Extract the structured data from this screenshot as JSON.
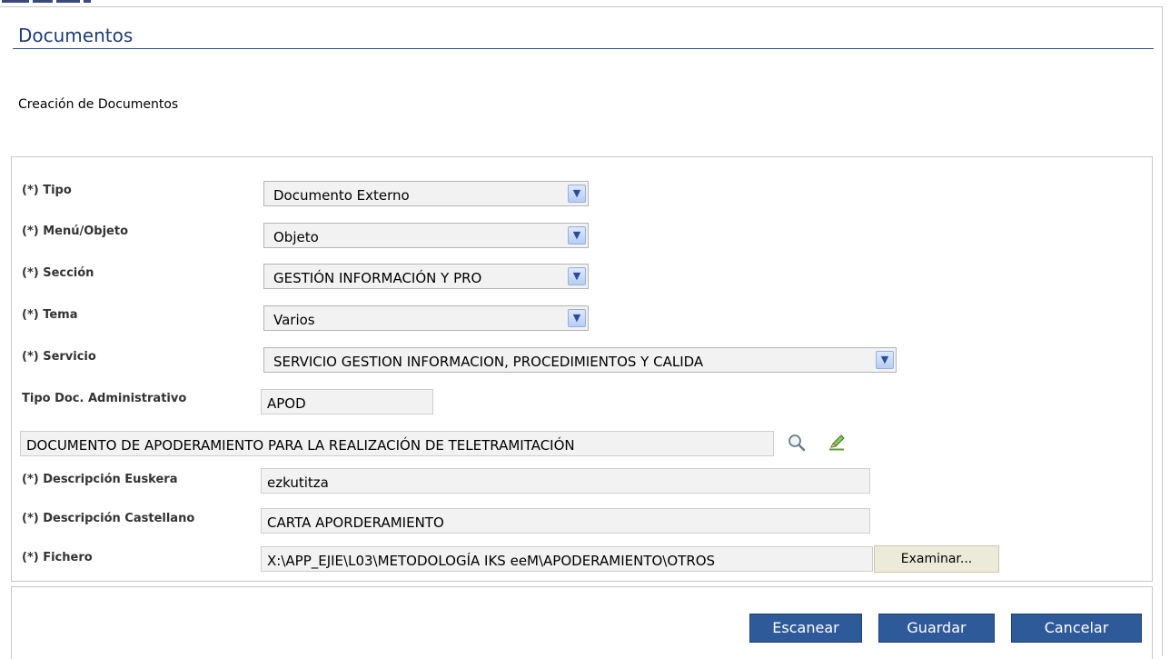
{
  "header": {
    "title": "Documentos",
    "subtitle": "Creación de Documentos"
  },
  "form": {
    "tipo": {
      "label": "(*) Tipo",
      "value": "Documento Externo"
    },
    "menu_objeto": {
      "label": "(*) Menú/Objeto",
      "value": "Objeto"
    },
    "seccion": {
      "label": "(*) Sección",
      "value": "GESTIÓN INFORMACIÓN Y PRO"
    },
    "tema": {
      "label": "(*) Tema",
      "value": "Varios"
    },
    "servicio": {
      "label": "(*) Servicio",
      "value": "SERVICIO GESTION INFORMACION, PROCEDIMIENTOS Y CALIDA"
    },
    "tipo_doc_admin": {
      "label": "Tipo Doc. Administrativo",
      "value": "APOD"
    },
    "documento_desc": {
      "value": "DOCUMENTO DE APODERAMIENTO PARA LA REALIZACIÓN DE TELETRAMITACIÓN"
    },
    "desc_euskera": {
      "label": "(*) Descripción Euskera",
      "value": "ezkutitza"
    },
    "desc_castellano": {
      "label": "(*) Descripción Castellano",
      "value": "CARTA APORDERAMIENTO"
    },
    "fichero": {
      "label": "(*) Fichero",
      "value": "X:\\APP_EJIE\\L03\\METODOLOGÍA IKS eeM\\APODERAMIENTO\\OTROS",
      "browse_label": "Examinar..."
    }
  },
  "icons": {
    "search": "magnifier-icon",
    "edit": "pencil-check-icon",
    "dropdown": "chevron-down-icon"
  },
  "buttons": {
    "scan": "Escanear",
    "save": "Guardar",
    "cancel": "Cancelar"
  },
  "colors": {
    "accent": "#2f5a99",
    "title": "#1f3d7a"
  }
}
